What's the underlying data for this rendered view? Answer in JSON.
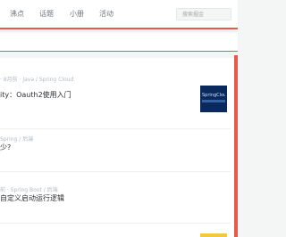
{
  "nav": {
    "items": [
      "沸点",
      "话题",
      "小册",
      "活动"
    ]
  },
  "search": {
    "placeholder": "搜索掘金"
  },
  "feed": {
    "entries": [
      {
        "meta": "· 8月前 · Java / Spring Cloud",
        "title": "ity：Oauth2使用入门",
        "thumb_text": "SpringCloud"
      },
      {
        "meta": "Spring / 后端",
        "title": "少?"
      },
      {
        "meta": "前 · Spring Boot / 后端",
        "title": "自定义启动运行逻辑"
      }
    ]
  },
  "colors": {
    "accent": "#e8584c",
    "thumb_bg": "#0a2a5e"
  }
}
